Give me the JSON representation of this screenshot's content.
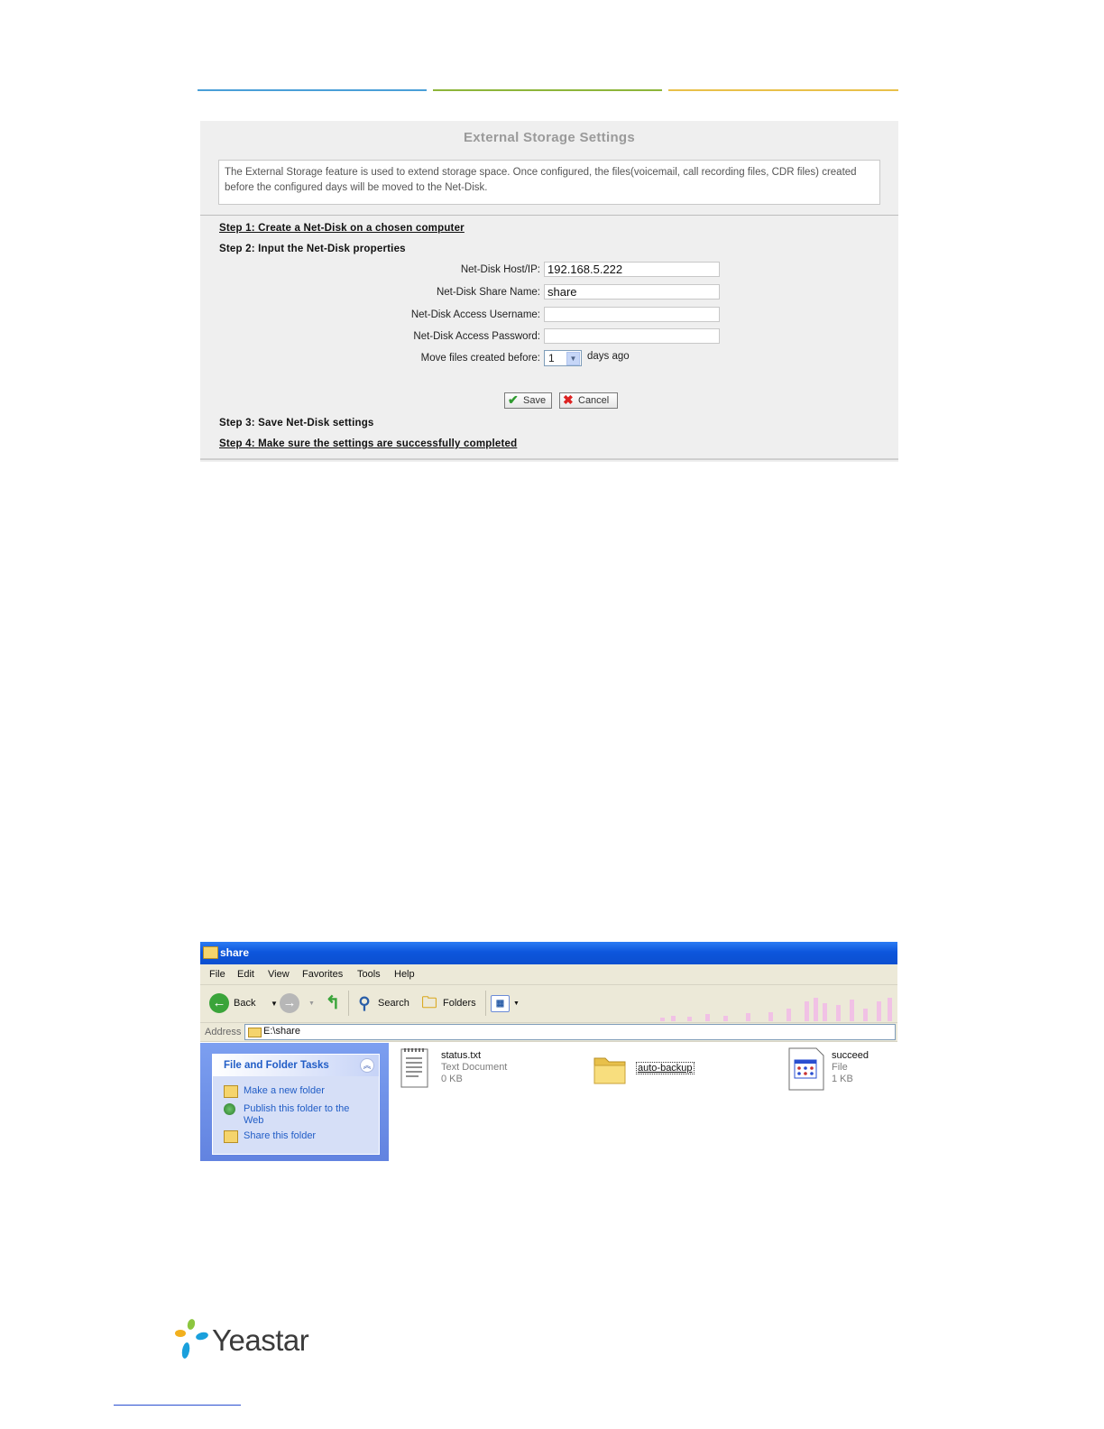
{
  "storage_panel": {
    "title": "External Storage Settings",
    "description": "The External Storage feature is used to extend storage space. Once configured, the files(voicemail, call recording files, CDR files) created before the configured days will be moved to the Net-Disk.",
    "step1": "Step 1: Create a Net-Disk on a chosen computer",
    "step2": "Step 2: Input the Net-Disk properties",
    "step3": "Step 3: Save Net-Disk settings",
    "step4": "Step 4: Make sure the settings are successfully completed",
    "fields": {
      "host_label": "Net-Disk Host/IP:",
      "host_value": "192.168.5.222",
      "share_label": "Net-Disk Share Name:",
      "share_value": "share",
      "username_label": "Net-Disk Access Username:",
      "username_value": "",
      "password_label": "Net-Disk Access Password:",
      "password_value": "",
      "move_label": "Move files created before:",
      "move_value": "1",
      "move_suffix": "days ago"
    },
    "save_label": "Save",
    "cancel_label": "Cancel"
  },
  "explorer": {
    "window_title": "share",
    "menu": [
      "File",
      "Edit",
      "View",
      "Favorites",
      "Tools",
      "Help"
    ],
    "toolbar": {
      "back": "Back",
      "search": "Search",
      "folders": "Folders"
    },
    "address_label": "Address",
    "address_value": "E:\\share",
    "tasks_title": "File and Folder Tasks",
    "tasks": [
      "Make a new folder",
      "Publish this folder to the Web",
      "Share this folder"
    ],
    "files": [
      {
        "name": "status.txt",
        "type": "Text Document",
        "size": "0 KB"
      },
      {
        "name": "auto-backup"
      },
      {
        "name": "succeed",
        "type": "File",
        "size": "1 KB"
      }
    ]
  },
  "logo": {
    "text": "Yeastar"
  },
  "colors": {
    "xp_blue": "#0b4fd0",
    "task_link": "#215dc6",
    "panel_bg": "#efefef"
  }
}
